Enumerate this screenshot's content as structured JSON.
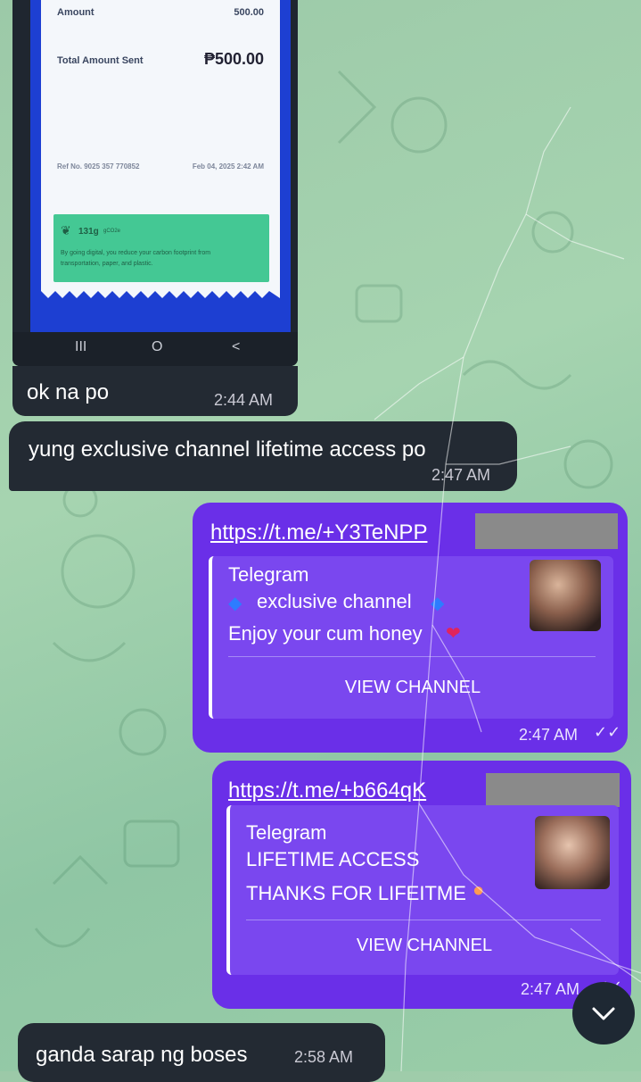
{
  "receipt": {
    "amount_label": "Amount",
    "amount_value": "500.00",
    "total_label": "Total Amount Sent",
    "total_value": "₱500.00",
    "ref_label": "Ref No. 9025 357 770852",
    "ref_date": "Feb 04, 2025 2:42 AM",
    "eco_title": "131g",
    "eco_sub": "gCO2e",
    "eco_text": "By going digital, you reduce your carbon footprint from transportation, paper, and plastic."
  },
  "phone_nav": {
    "recents": "III",
    "home": "O",
    "back": "<"
  },
  "messages": {
    "m1": {
      "text": "ok na po",
      "time": "2:44 AM"
    },
    "m2": {
      "text": "yung exclusive channel lifetime access po",
      "time": "2:47 AM"
    },
    "m3": {
      "link": "https://t.me/+Y3TeNPP",
      "site": "Telegram",
      "title": "exclusive channel",
      "desc": "Enjoy your cum honey",
      "button": "VIEW CHANNEL",
      "time": "2:47 AM"
    },
    "m4": {
      "link": "https://t.me/+b664qK",
      "site": "Telegram",
      "title": "LIFETIME ACCESS",
      "desc": "THANKS FOR LIFEITME",
      "button": "VIEW CHANNEL",
      "time": "2:47 AM"
    },
    "m5": {
      "text": "ganda sarap ng boses",
      "time": "2:58 AM"
    }
  },
  "colors": {
    "outgoing": "#6a2fe8",
    "incoming": "#232a33",
    "background": "#9cc9a8"
  },
  "icons": [
    "diamond-icon",
    "kiss-mark-icon",
    "peach-icon",
    "double-check-icon",
    "chevron-down-icon",
    "leaf-icon"
  ]
}
